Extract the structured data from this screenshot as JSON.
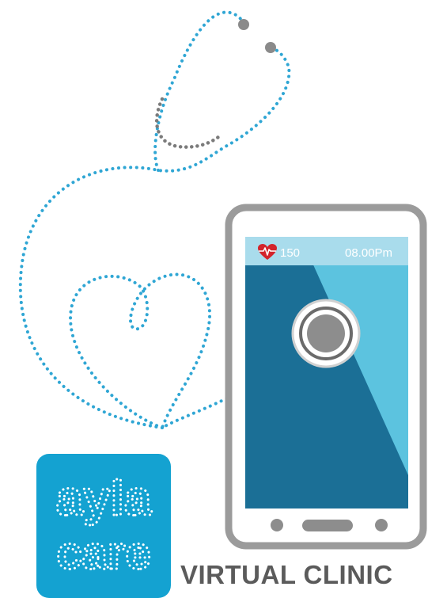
{
  "brand": {
    "logo_text_top": "ayla",
    "logo_text_bottom": "care",
    "tagline": "VIRTUAL CLINIC"
  },
  "phone_status": {
    "heart_rate": "150",
    "time": "08.00Pm"
  },
  "colors": {
    "dots_blue": "#2fa6d4",
    "dots_grey": "#7b7b7b",
    "logo_bg": "#14a2d1",
    "screen_dark": "#1b6f96",
    "screen_light": "#5cc3df",
    "status_bar": "#a9dcec",
    "phone_frame": "#9b9b9b",
    "heart": "#d3242b",
    "text_grey": "#5b5b5b"
  }
}
